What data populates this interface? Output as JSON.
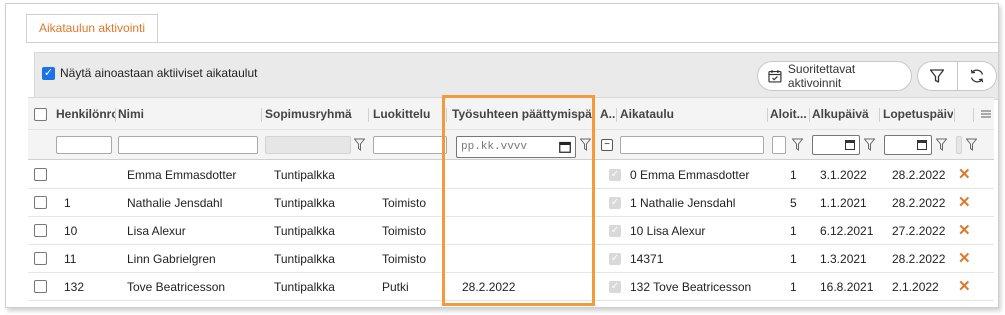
{
  "tab": {
    "label": "Aikataulun aktivointi"
  },
  "toolbar": {
    "checkbox_label": "Näytä ainoastaan aktiiviset aikataulut",
    "checkbox_checked": true,
    "run_button_label": "Suoritettavat aktivoinnit",
    "filter_icon": "funnel-icon",
    "refresh_icon": "refresh-icon"
  },
  "columns": {
    "henkilonro": "Henkilönro",
    "nimi": "Nimi",
    "sopimusryhma": "Sopimusryhmä",
    "luokittelu": "Luokittelu",
    "tyosuhde": "Työsuhteen päättymispäivä",
    "a": "A...",
    "aikataulu": "Aikataulu",
    "aloit": "Aloit...",
    "alkupaiva": "Alkupäivä",
    "lopetuspaiva": "Lopetuspäivä"
  },
  "filters": {
    "date_placeholder": "pp.kk.vvvv"
  },
  "rows": [
    {
      "henkilonro": "",
      "nimi": "Emma Emmasdotter",
      "sopimusryhma": "Tuntipalkka",
      "luokittelu": "",
      "tyosuhde": "",
      "aikataulu": "0 Emma Emmasdotter",
      "aloit": "1",
      "alkupaiva": "3.1.2022",
      "lopetuspaiva": "28.2.2022"
    },
    {
      "henkilonro": "1",
      "nimi": "Nathalie Jensdahl",
      "sopimusryhma": "Tuntipalkka",
      "luokittelu": "Toimisto",
      "tyosuhde": "",
      "aikataulu": "1 Nathalie Jensdahl",
      "aloit": "5",
      "alkupaiva": "1.1.2021",
      "lopetuspaiva": "28.2.2022"
    },
    {
      "henkilonro": "10",
      "nimi": "Lisa Alexur",
      "sopimusryhma": "Tuntipalkka",
      "luokittelu": "Toimisto",
      "tyosuhde": "",
      "aikataulu": "10 Lisa Alexur",
      "aloit": "1",
      "alkupaiva": "6.12.2021",
      "lopetuspaiva": "27.2.2022"
    },
    {
      "henkilonro": "11",
      "nimi": "Linn Gabrielgren",
      "sopimusryhma": "Tuntipalkka",
      "luokittelu": "Toimisto",
      "tyosuhde": "",
      "aikataulu": "14371",
      "aloit": "1",
      "alkupaiva": "1.3.2021",
      "lopetuspaiva": "28.2.2022"
    },
    {
      "henkilonro": "132",
      "nimi": "Tove Beatricesson",
      "sopimusryhma": "Tuntipalkka",
      "luokittelu": "Putki",
      "tyosuhde": "28.2.2022",
      "aikataulu": "132 Tove Beatricesson",
      "aloit": "1",
      "alkupaiva": "16.8.2021",
      "lopetuspaiva": "2.1.2022"
    }
  ],
  "colors": {
    "accent": "#e0782a",
    "highlight": "#f39a3c",
    "checkbox_blue": "#1a73e8"
  }
}
